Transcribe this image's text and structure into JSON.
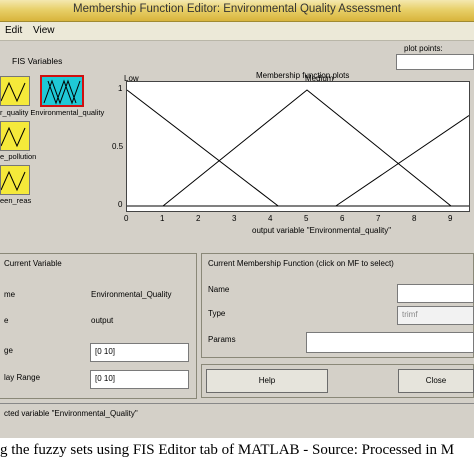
{
  "window": {
    "title": "Membership Function Editor: Environmental Quality Assessment"
  },
  "menu": {
    "items": [
      "Edit",
      "View"
    ]
  },
  "fis": {
    "header": "FIS Variables",
    "variables": [
      {
        "label": "r_quality Environmental_quality"
      },
      {
        "label": "e_pollution"
      },
      {
        "label": "een_reas"
      }
    ]
  },
  "plot": {
    "points_label": "plot points:",
    "title": "Membership function plots",
    "mf_labels": [
      "Low",
      "Medium"
    ],
    "xlabel": "output variable \"Environmental_quality\"",
    "x_ticks": [
      "0",
      "1",
      "2",
      "3",
      "4",
      "5",
      "6",
      "7",
      "8",
      "9"
    ],
    "y_ticks": [
      "1",
      "0.5",
      "0"
    ]
  },
  "chart_data": {
    "type": "line",
    "xlabel": "output variable \"Environmental_quality\"",
    "ylabel": "",
    "xlim": [
      0,
      9.5
    ],
    "ylim": [
      0,
      1
    ],
    "series": [
      {
        "name": "Low",
        "x": [
          0,
          4.2
        ],
        "y": [
          1,
          0
        ]
      },
      {
        "name": "Medium",
        "x": [
          1,
          5,
          9
        ],
        "y": [
          0,
          1,
          0
        ]
      },
      {
        "x": [
          5.8,
          9.5
        ],
        "y": [
          0,
          0.78
        ]
      }
    ]
  },
  "current_variable": {
    "header": "Current Variable",
    "rows": [
      {
        "label": "me",
        "value": "Environmental_Quality"
      },
      {
        "label": "e",
        "value": "output"
      },
      {
        "label": "ge",
        "value": "[0 10]"
      },
      {
        "label": "lay Range",
        "value": "[0 10]"
      }
    ]
  },
  "current_mf": {
    "header": "Current Membership Function (click on MF to select)",
    "name_label": "Name",
    "type_label": "Type",
    "type_value": "trimf",
    "params_label": "Params"
  },
  "buttons": {
    "help": "Help",
    "close": "Close"
  },
  "status": "cted variable \"Environmental_Quality\"",
  "caption": "g the fuzzy sets using FIS Editor tab of MATLAB - Source: Processed in M"
}
